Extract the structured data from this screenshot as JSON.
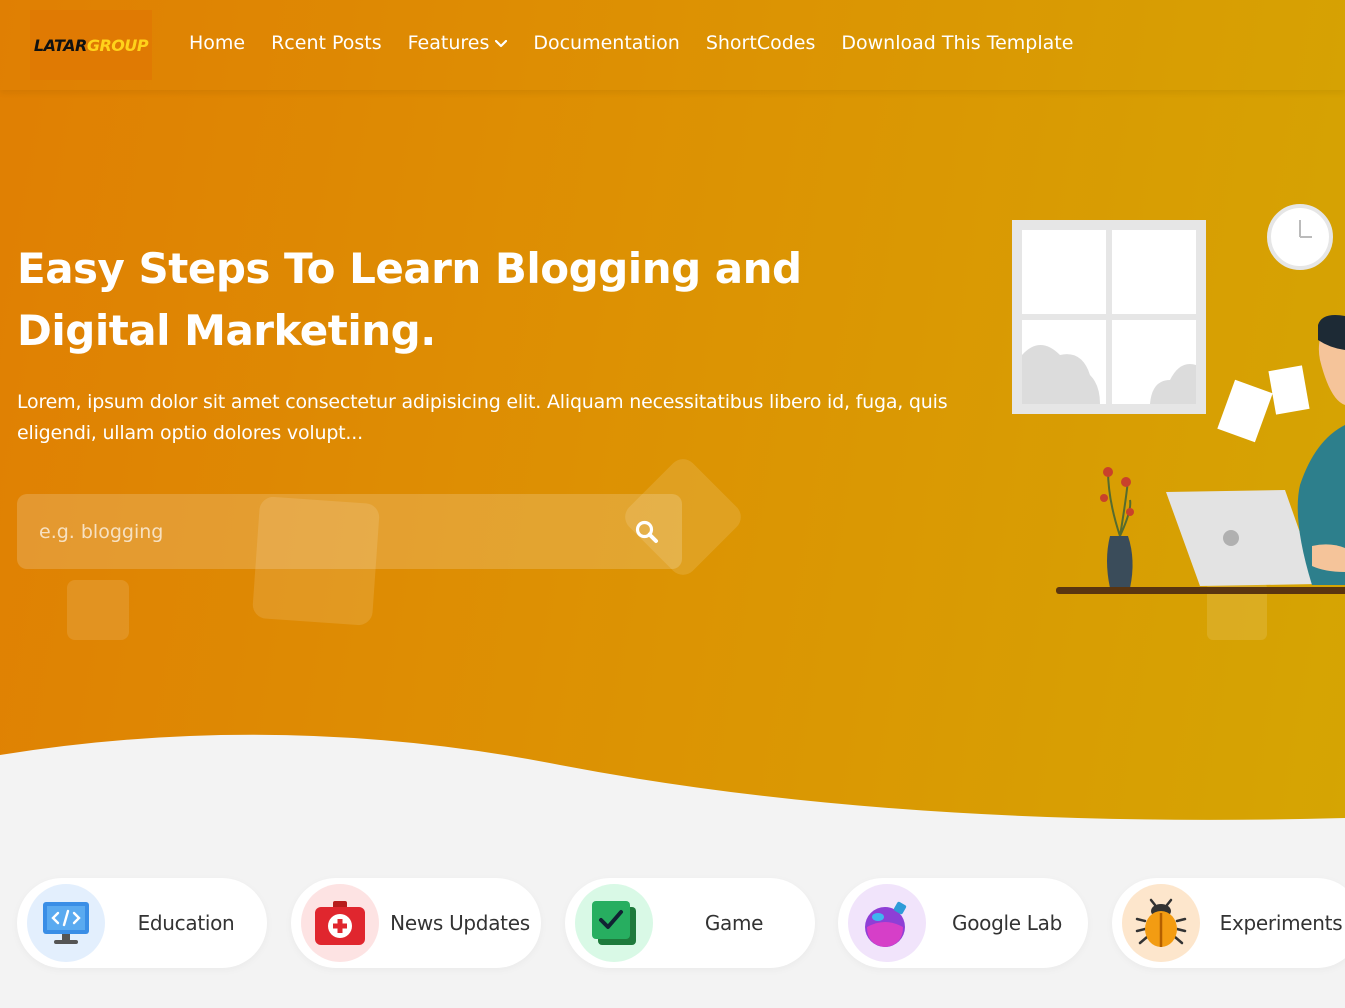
{
  "brand": {
    "logo_part1": "LATAR",
    "logo_part2": "GROUP"
  },
  "nav": {
    "items": [
      {
        "label": "Home"
      },
      {
        "label": "Rcent Posts"
      },
      {
        "label": "Features",
        "has_dropdown": true
      },
      {
        "label": "Documentation"
      },
      {
        "label": "ShortCodes"
      },
      {
        "label": "Download This Template"
      }
    ]
  },
  "hero": {
    "title": "Easy Steps To Learn Blogging and Digital Marketing.",
    "description": "Lorem, ipsum dolor sit amet consectetur adipisicing elit. Aliquam necessitatibus libero id, fuga, quis eligendi, ullam optio dolores volupt...",
    "search": {
      "placeholder": "e.g. blogging",
      "value": "",
      "icon": "search-icon"
    },
    "illustration": "person-working-at-laptop"
  },
  "categories": [
    {
      "label": "Education",
      "icon": "monitor-code-icon",
      "bg": "#e3effd"
    },
    {
      "label": "News Updates",
      "icon": "first-aid-kit-icon",
      "bg": "#fde3e3"
    },
    {
      "label": "Game",
      "icon": "checkbox-icon",
      "bg": "#d9f9e6"
    },
    {
      "label": "Google Lab",
      "icon": "potion-flask-icon",
      "bg": "#f1e4fb"
    },
    {
      "label": "Experiments",
      "icon": "bug-icon",
      "bg": "#fde6cc"
    }
  ],
  "colors": {
    "hero_start": "#e07f03",
    "hero_end": "#d5a503",
    "page_bg": "#f3f3f3"
  }
}
